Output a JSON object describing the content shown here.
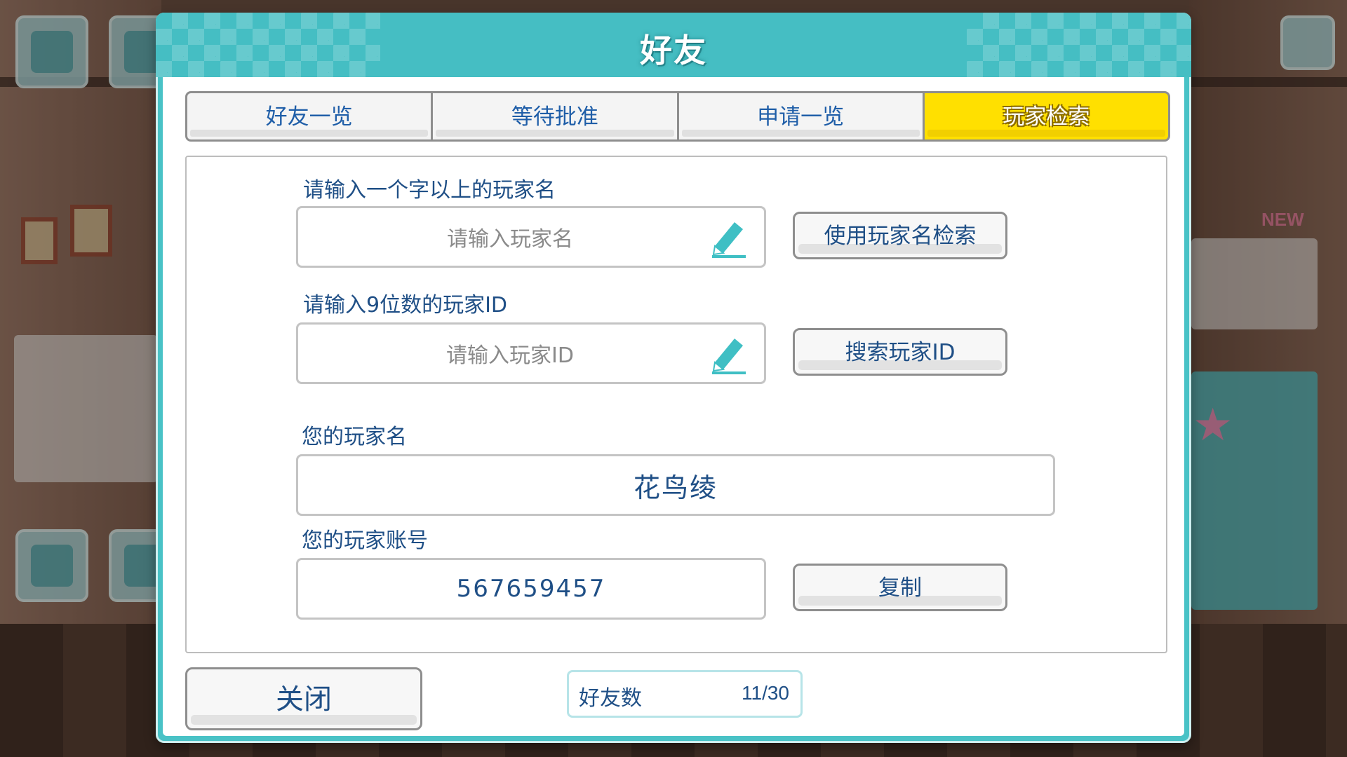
{
  "dialog": {
    "title": "好友"
  },
  "tabs": [
    {
      "label": "好友一览",
      "active": false
    },
    {
      "label": "等待批准",
      "active": false
    },
    {
      "label": "申请一览",
      "active": false
    },
    {
      "label": "玩家检索",
      "active": true
    }
  ],
  "search_by_name": {
    "label": "请输入一个字以上的玩家名",
    "placeholder": "请输入玩家名",
    "button": "使用玩家名检索"
  },
  "search_by_id": {
    "label": "请输入9位数的玩家ID",
    "placeholder": "请输入玩家ID",
    "button": "搜索玩家ID"
  },
  "your_name": {
    "label": "您的玩家名",
    "value": "花鸟绫"
  },
  "your_account": {
    "label": "您的玩家账号",
    "value": "567659457",
    "copy_button": "复制"
  },
  "footer": {
    "close_button": "关闭",
    "friend_count_label": "好友数",
    "friend_count_value": "11/30"
  },
  "colors": {
    "header_teal": "#49c2c6",
    "active_tab_yellow": "#ffe000",
    "text_blue": "#1f4f86",
    "pencil_teal": "#3fbfc4"
  },
  "icons": {
    "edit": "pencil-icon"
  }
}
